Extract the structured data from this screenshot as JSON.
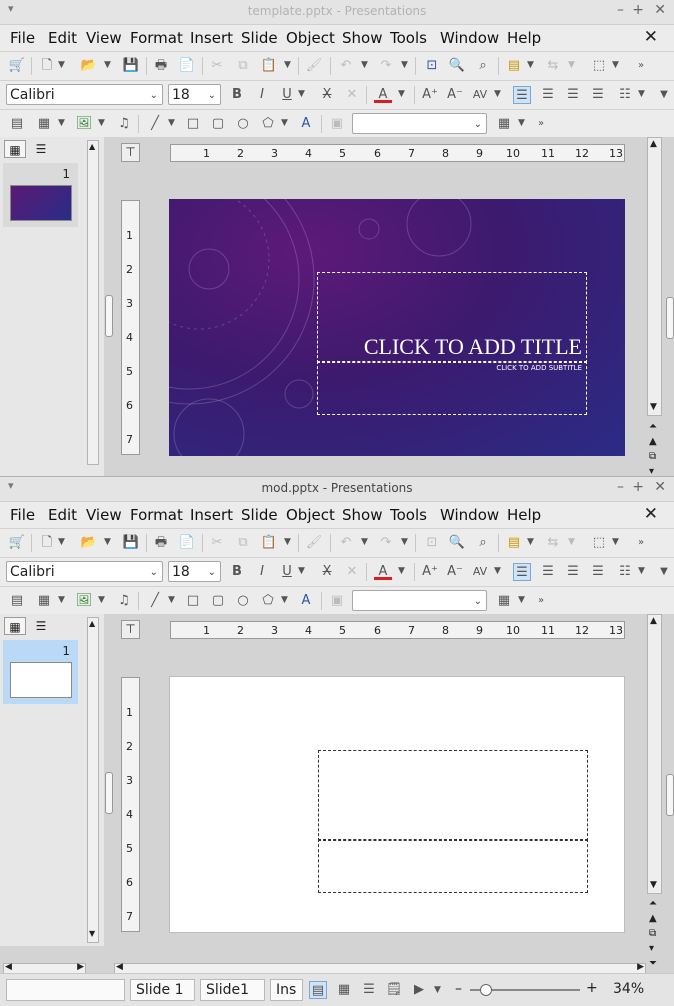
{
  "window1": {
    "title": "template.pptx - Presentations"
  },
  "window2": {
    "title": "mod.pptx - Presentations"
  },
  "menu": [
    "File",
    "Edit",
    "View",
    "Format",
    "Insert",
    "Slide",
    "Object",
    "Show",
    "Tools",
    "Window",
    "Help"
  ],
  "font": {
    "name": "Calibri",
    "size": "18"
  },
  "ruler_h": [
    "1",
    "2",
    "3",
    "4",
    "5",
    "6",
    "7",
    "8",
    "9",
    "10",
    "11",
    "12",
    "13"
  ],
  "ruler_v": [
    "1",
    "2",
    "3",
    "4",
    "5",
    "6",
    "7"
  ],
  "slide_panel": {
    "slide_number": "1"
  },
  "slide1": {
    "title": "CLICK TO ADD TITLE",
    "subtitle": "CLICK TO ADD SUBTITLE"
  },
  "status": {
    "field": "",
    "slide": "Slide 1",
    "layout": "Slide1",
    "mode": "Ins",
    "zoom": "34%"
  },
  "colors": {
    "accent_font": "#d42020",
    "thumb_selected": "#b9d9f7"
  }
}
